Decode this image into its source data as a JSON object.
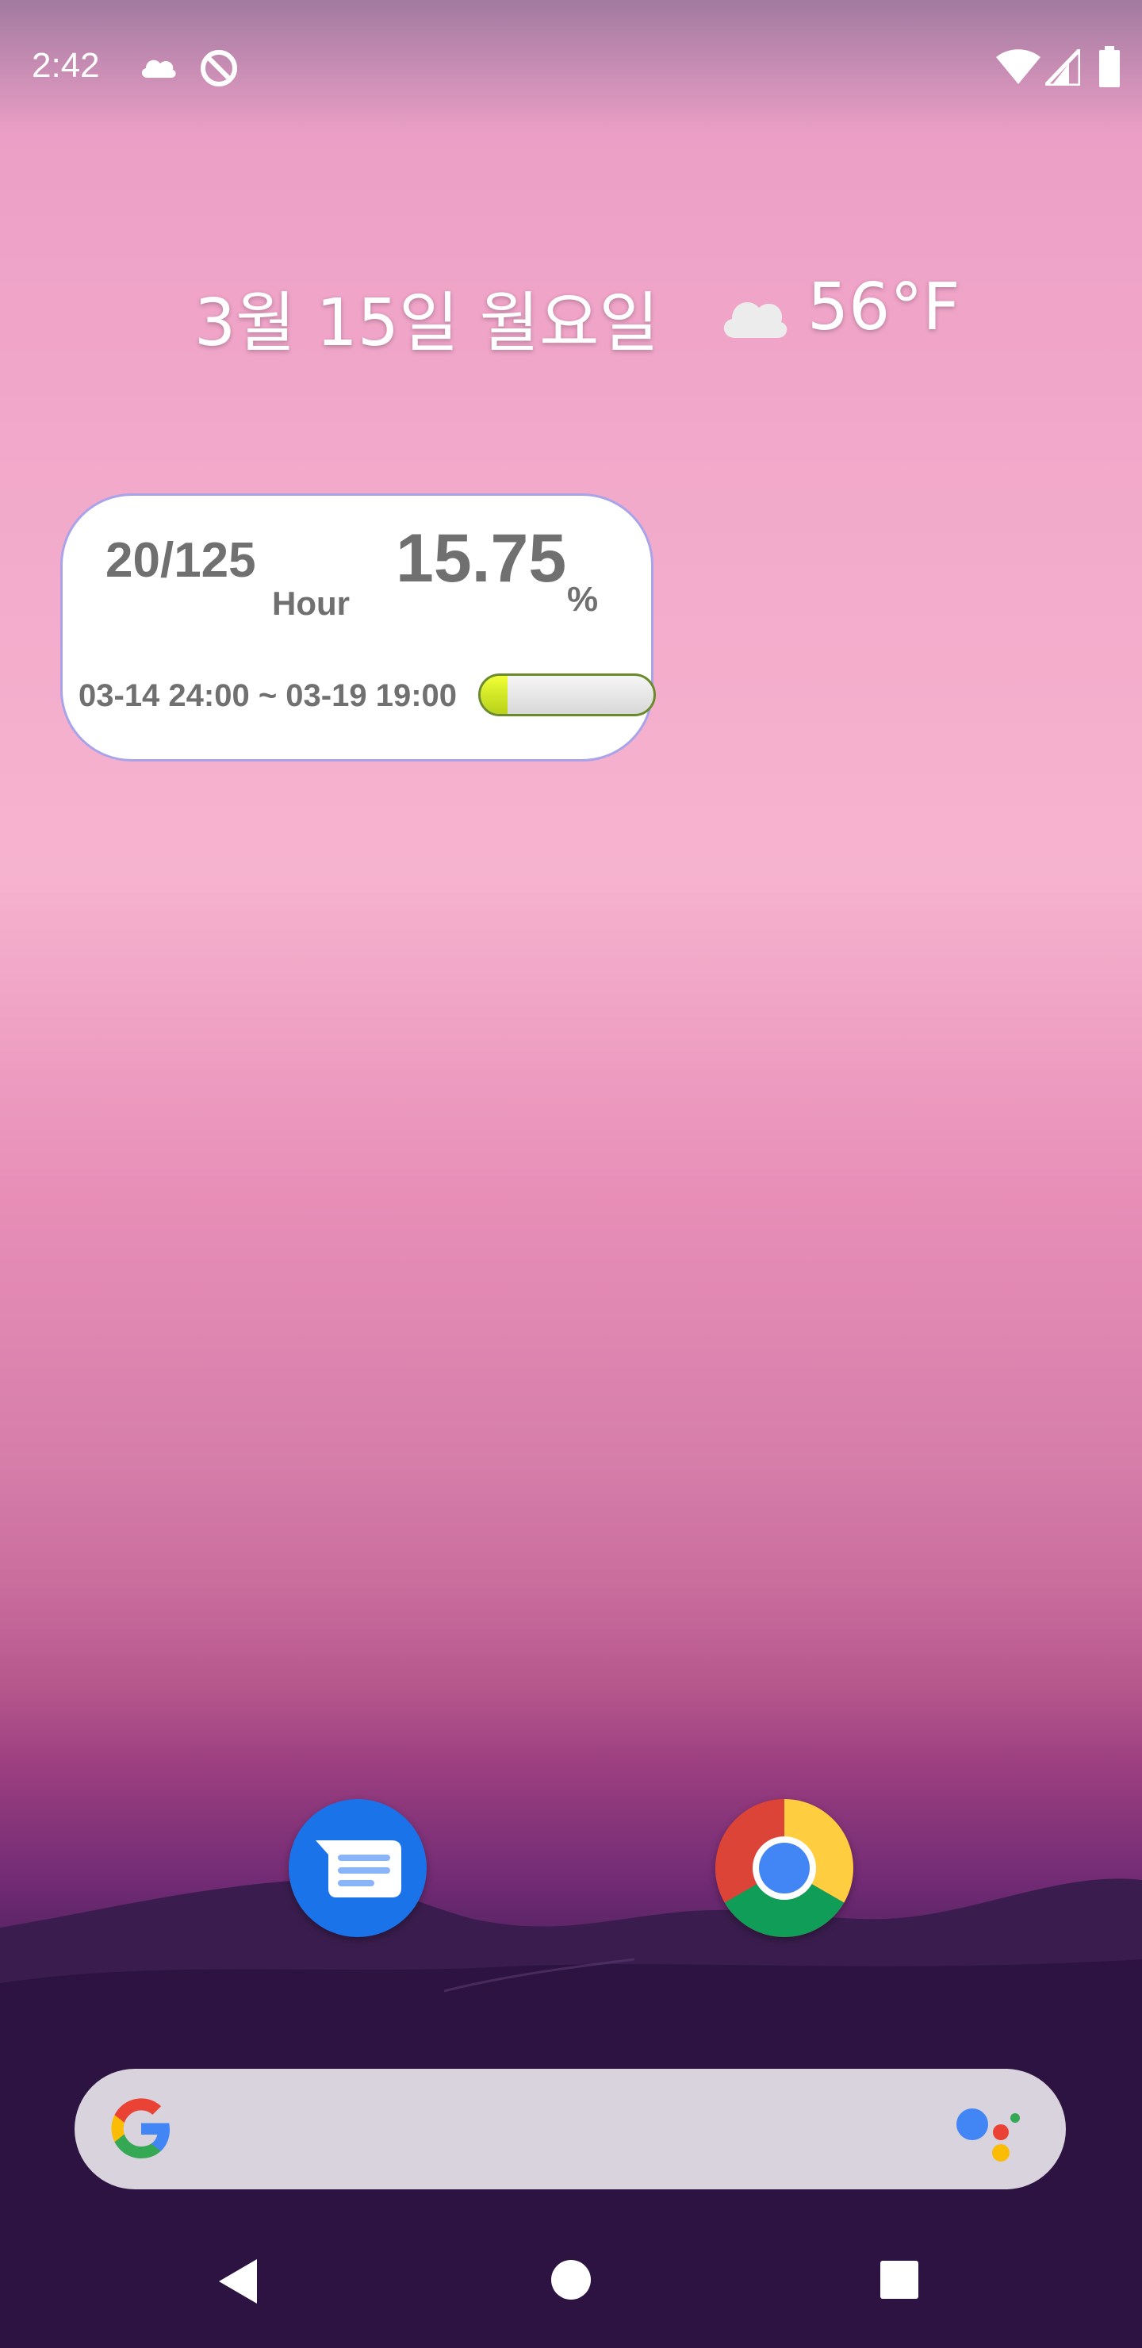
{
  "status_bar": {
    "time": "2:42",
    "left_icons": [
      "cloud-icon",
      "do-not-disturb-icon"
    ],
    "right_icons": [
      "wifi-icon",
      "cell-signal-icon",
      "battery-icon"
    ]
  },
  "glance": {
    "date": "3월 15일 월요일",
    "weather_icon": "cloud-icon",
    "temperature": "56°F"
  },
  "widget": {
    "ratio": "20/125",
    "unit": "Hour",
    "percent_value": "15.75",
    "percent_sign": "%",
    "range": "03-14 24:00 ~ 03-19 19:00",
    "progress": 0.1575,
    "border_color": "#a9a3ea",
    "progress_fill_color": "#d8ef1e"
  },
  "dock": {
    "apps": [
      {
        "name": "Messages",
        "icon": "messages-icon",
        "color": "#1a73e8"
      },
      {
        "name": "Chrome",
        "icon": "chrome-icon"
      }
    ]
  },
  "search": {
    "logo": "google-g-logo",
    "assistant_icon": "google-assistant-icon"
  },
  "nav": {
    "buttons": [
      "back-icon",
      "home-icon",
      "recents-icon"
    ]
  }
}
